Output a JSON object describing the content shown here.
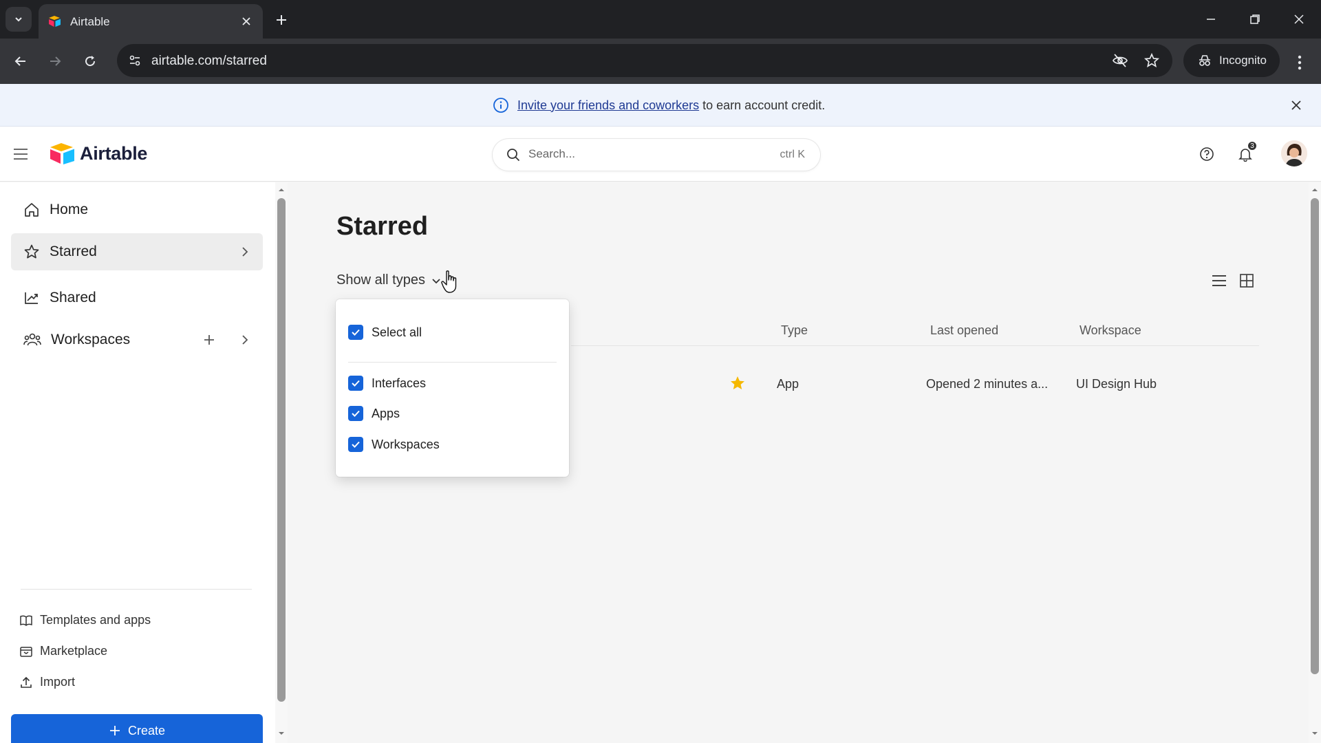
{
  "browser": {
    "tab_title": "Airtable",
    "url": "airtable.com/starred",
    "incognito_label": "Incognito"
  },
  "banner": {
    "link_text": "Invite your friends and coworkers",
    "text": "to earn account credit."
  },
  "header": {
    "logo_text": "Airtable",
    "search_placeholder": "Search...",
    "search_shortcut": "ctrl K",
    "notification_count": "3"
  },
  "sidebar": {
    "items": [
      {
        "label": "Home",
        "icon": "home-icon"
      },
      {
        "label": "Starred",
        "icon": "star-outline-icon",
        "active": true
      },
      {
        "label": "Shared",
        "icon": "shared-icon"
      },
      {
        "label": "Workspaces",
        "icon": "workspaces-icon"
      }
    ],
    "footer_links": [
      {
        "label": "Templates and apps",
        "icon": "book-icon"
      },
      {
        "label": "Marketplace",
        "icon": "marketplace-icon"
      },
      {
        "label": "Import",
        "icon": "upload-icon"
      }
    ],
    "create_label": "Create"
  },
  "main": {
    "title": "Starred",
    "filter_label": "Show all types",
    "columns": [
      "Type",
      "Last opened",
      "Workspace"
    ],
    "rows": [
      {
        "starred": true,
        "type": "App",
        "last_opened": "Opened 2 minutes a...",
        "workspace": "UI Design Hub"
      }
    ]
  },
  "dropdown": {
    "select_all": "Select all",
    "options": [
      {
        "label": "Interfaces",
        "checked": true
      },
      {
        "label": "Apps",
        "checked": true
      },
      {
        "label": "Workspaces",
        "checked": true
      }
    ]
  },
  "colors": {
    "accent": "#1664d9",
    "star": "#f5b800",
    "chrome_dark": "#202124",
    "banner_bg": "#eef3fc"
  }
}
